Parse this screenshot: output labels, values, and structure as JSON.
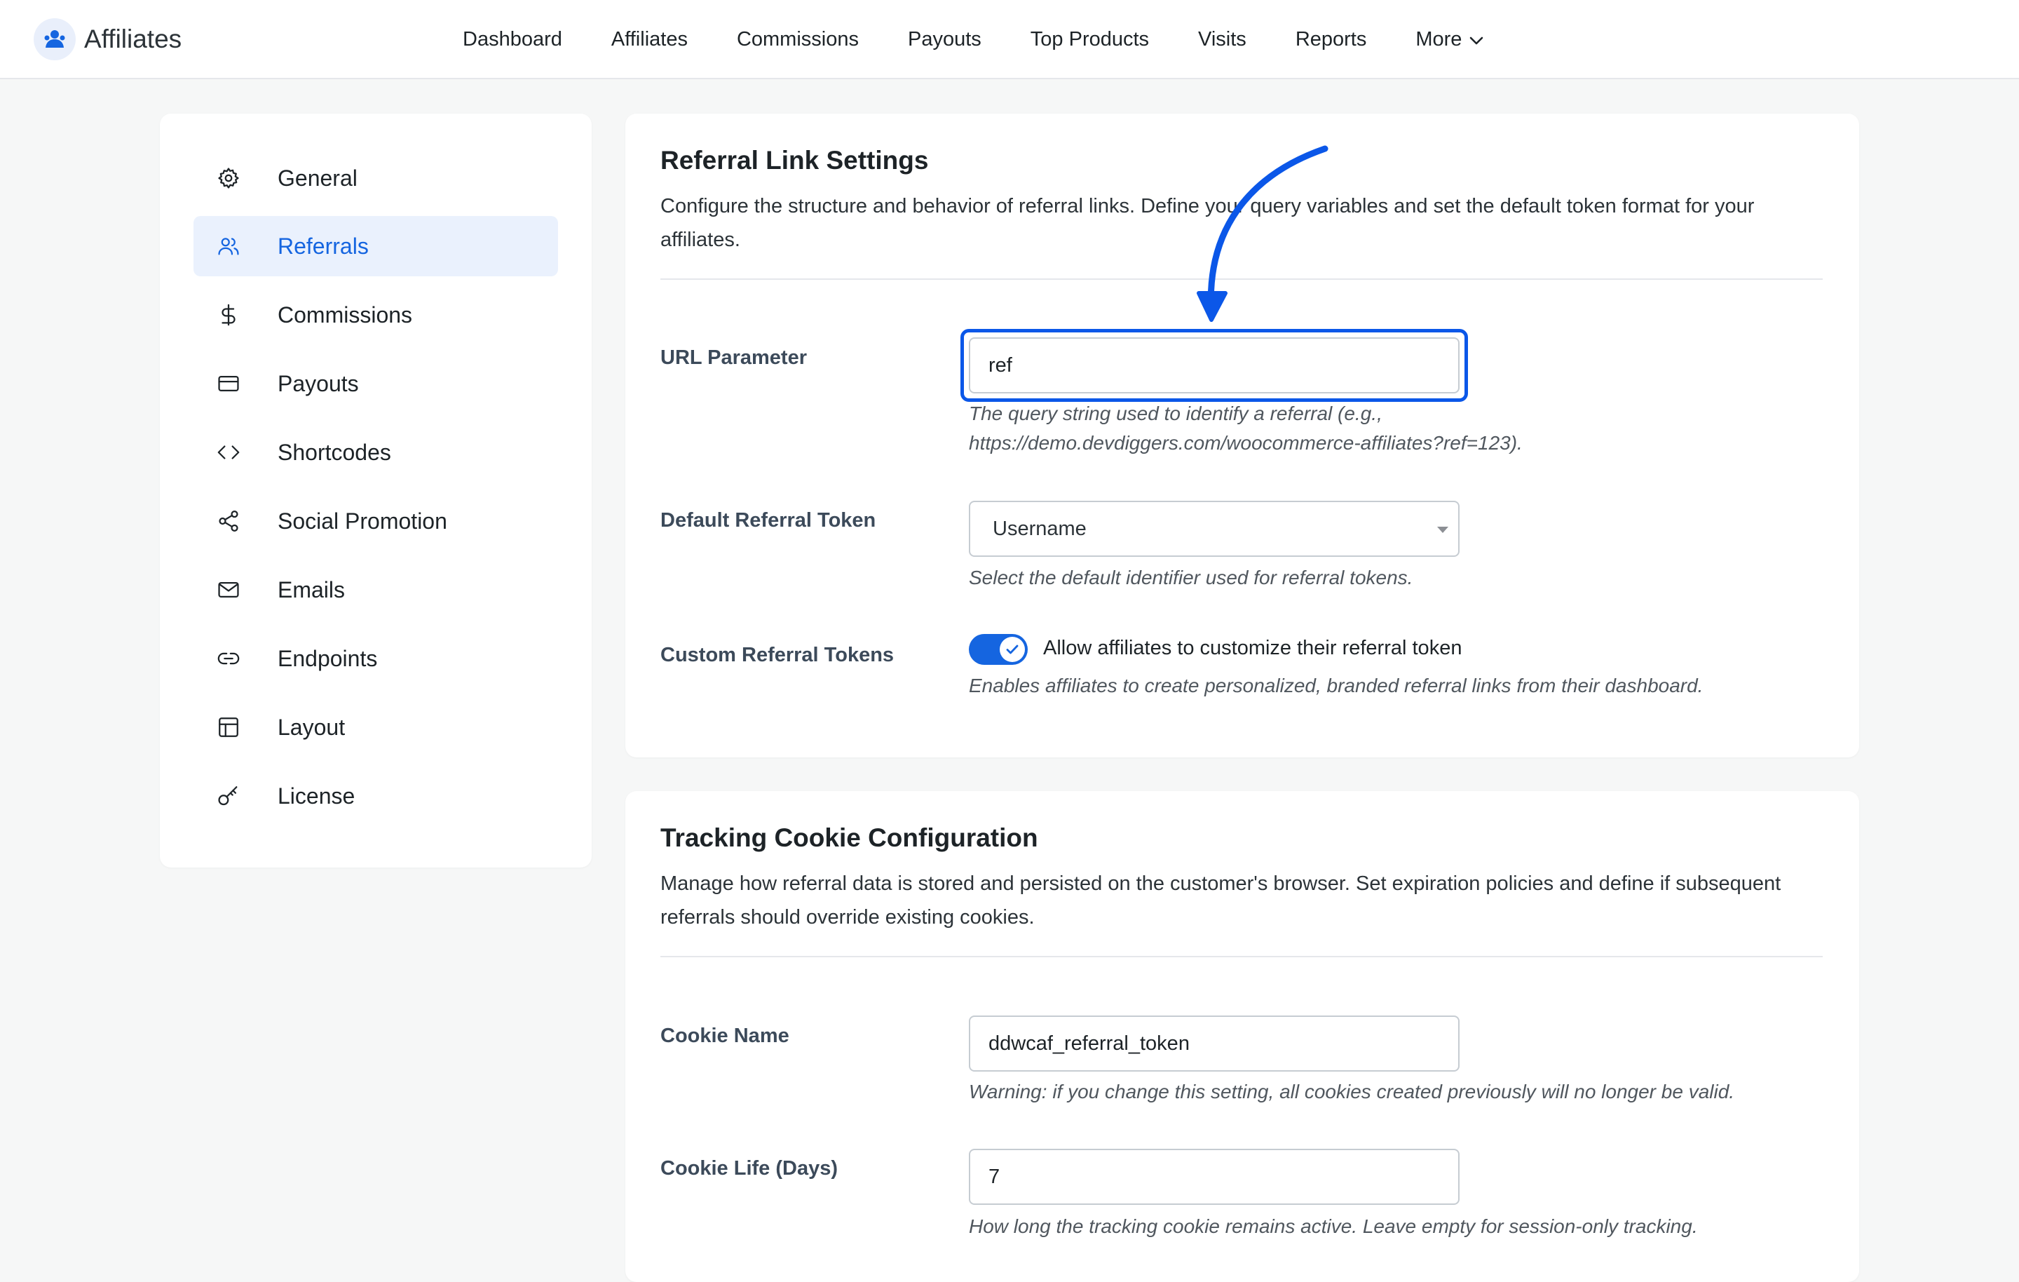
{
  "app": {
    "title": "Affiliates"
  },
  "nav": {
    "items": [
      "Dashboard",
      "Affiliates",
      "Commissions",
      "Payouts",
      "Top Products",
      "Visits",
      "Reports"
    ],
    "more_label": "More"
  },
  "sidebar": {
    "items": [
      {
        "label": "General",
        "icon": "gear-icon"
      },
      {
        "label": "Referrals",
        "icon": "users-icon",
        "active": true
      },
      {
        "label": "Commissions",
        "icon": "dollar-icon"
      },
      {
        "label": "Payouts",
        "icon": "credit-card-icon"
      },
      {
        "label": "Shortcodes",
        "icon": "code-icon"
      },
      {
        "label": "Social Promotion",
        "icon": "share-icon"
      },
      {
        "label": "Emails",
        "icon": "mail-icon"
      },
      {
        "label": "Endpoints",
        "icon": "link-icon"
      },
      {
        "label": "Layout",
        "icon": "layout-icon"
      },
      {
        "label": "License",
        "icon": "key-icon"
      }
    ]
  },
  "referral_settings": {
    "title": "Referral Link Settings",
    "description": "Configure the structure and behavior of referral links. Define your query variables and set the default token format for your affiliates.",
    "url_parameter": {
      "label": "URL Parameter",
      "value": "ref",
      "help": "The query string used to identify a referral (e.g., https://demo.devdiggers.com/woocommerce-affiliates?ref=123)."
    },
    "default_token": {
      "label": "Default Referral Token",
      "value": "Username",
      "help": "Select the default identifier used for referral tokens."
    },
    "custom_tokens": {
      "label": "Custom Referral Tokens",
      "toggle_label": "Allow affiliates to customize their referral token",
      "enabled": true,
      "help": "Enables affiliates to create personalized, branded referral links from their dashboard."
    }
  },
  "cookie_settings": {
    "title": "Tracking Cookie Configuration",
    "description": "Manage how referral data is stored and persisted on the customer's browser. Set expiration policies and define if subsequent referrals should override existing cookies.",
    "cookie_name": {
      "label": "Cookie Name",
      "value": "ddwcaf_referral_token",
      "help": "Warning: if you change this setting, all cookies created previously will no longer be valid."
    },
    "cookie_life": {
      "label": "Cookie Life (Days)",
      "value": "7",
      "help": "How long the tracking cookie remains active. Leave empty for session-only tracking."
    }
  },
  "colors": {
    "accent": "#1565e0",
    "annotation": "#0b57e8",
    "active_bg": "#eaf1fd"
  }
}
